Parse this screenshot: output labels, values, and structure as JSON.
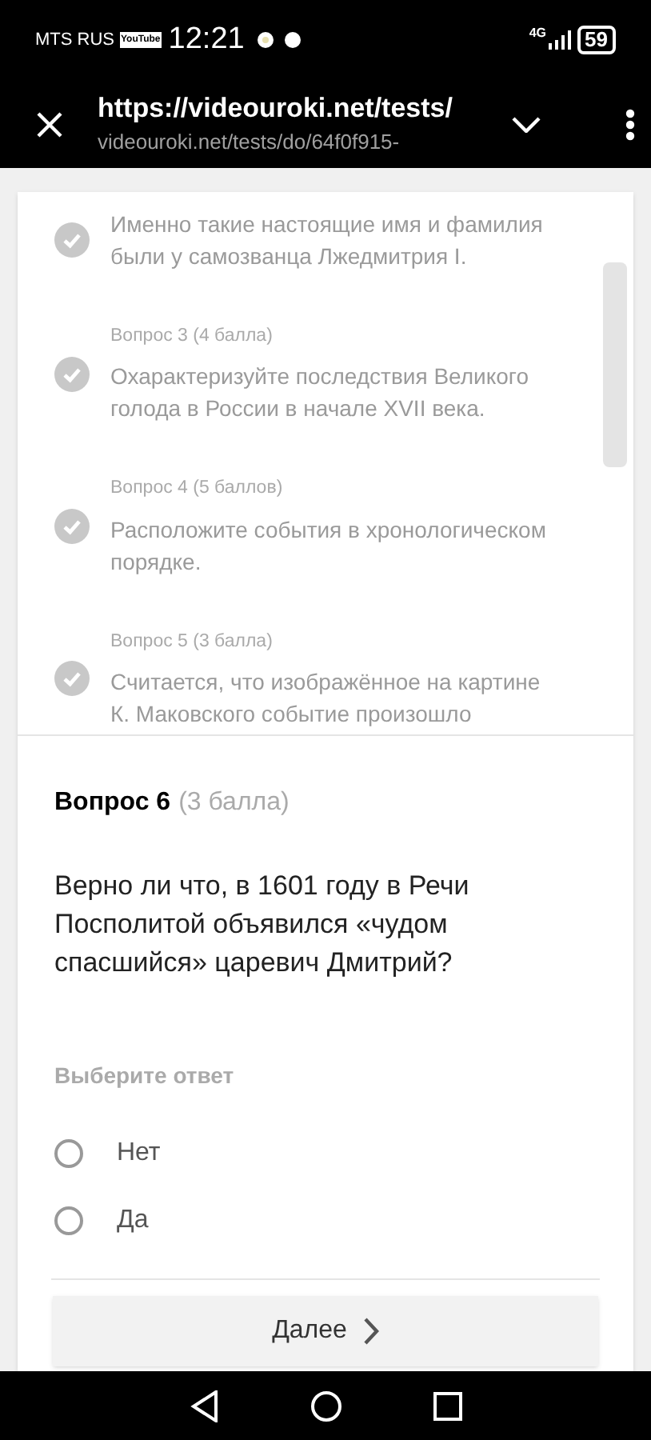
{
  "status_bar": {
    "carrier": "MTS RUS",
    "badge": "YouTube",
    "time": "12:21",
    "network": "4G",
    "battery": "59"
  },
  "browser": {
    "url": "https://videouroki.net/tests/",
    "subtitle": "videouroki.net/tests/do/64f0f915-"
  },
  "answered_questions": [
    {
      "text": "Именно такие настоящие имя и фамилия были у самозванца Лжедмитрия I.",
      "done": true
    },
    {
      "label": "Вопрос 3 (4 балла)",
      "text": "Охарактеризуйте последствия Великого голода в России в начале XVII века.",
      "done": true
    },
    {
      "label": "Вопрос 4 (5 баллов)",
      "text": "Расположите события в хронологическом порядке.",
      "done": true
    },
    {
      "label": "Вопрос 5 (3 балла)",
      "text": "Считается, что изображённое на картине К. Маковского событие произошло",
      "done": true
    }
  ],
  "question": {
    "title": "Вопрос 6",
    "points": "(3 балла)",
    "text": "Верно ли что, в 1601 году в Речи Посполитой объявился «чудом спасшийся» царевич Дмитрий?",
    "prompt": "Выберите ответ",
    "options": [
      {
        "label": "Нет",
        "selected": false
      },
      {
        "label": "Да",
        "selected": false
      }
    ]
  },
  "next_button": "Далее"
}
